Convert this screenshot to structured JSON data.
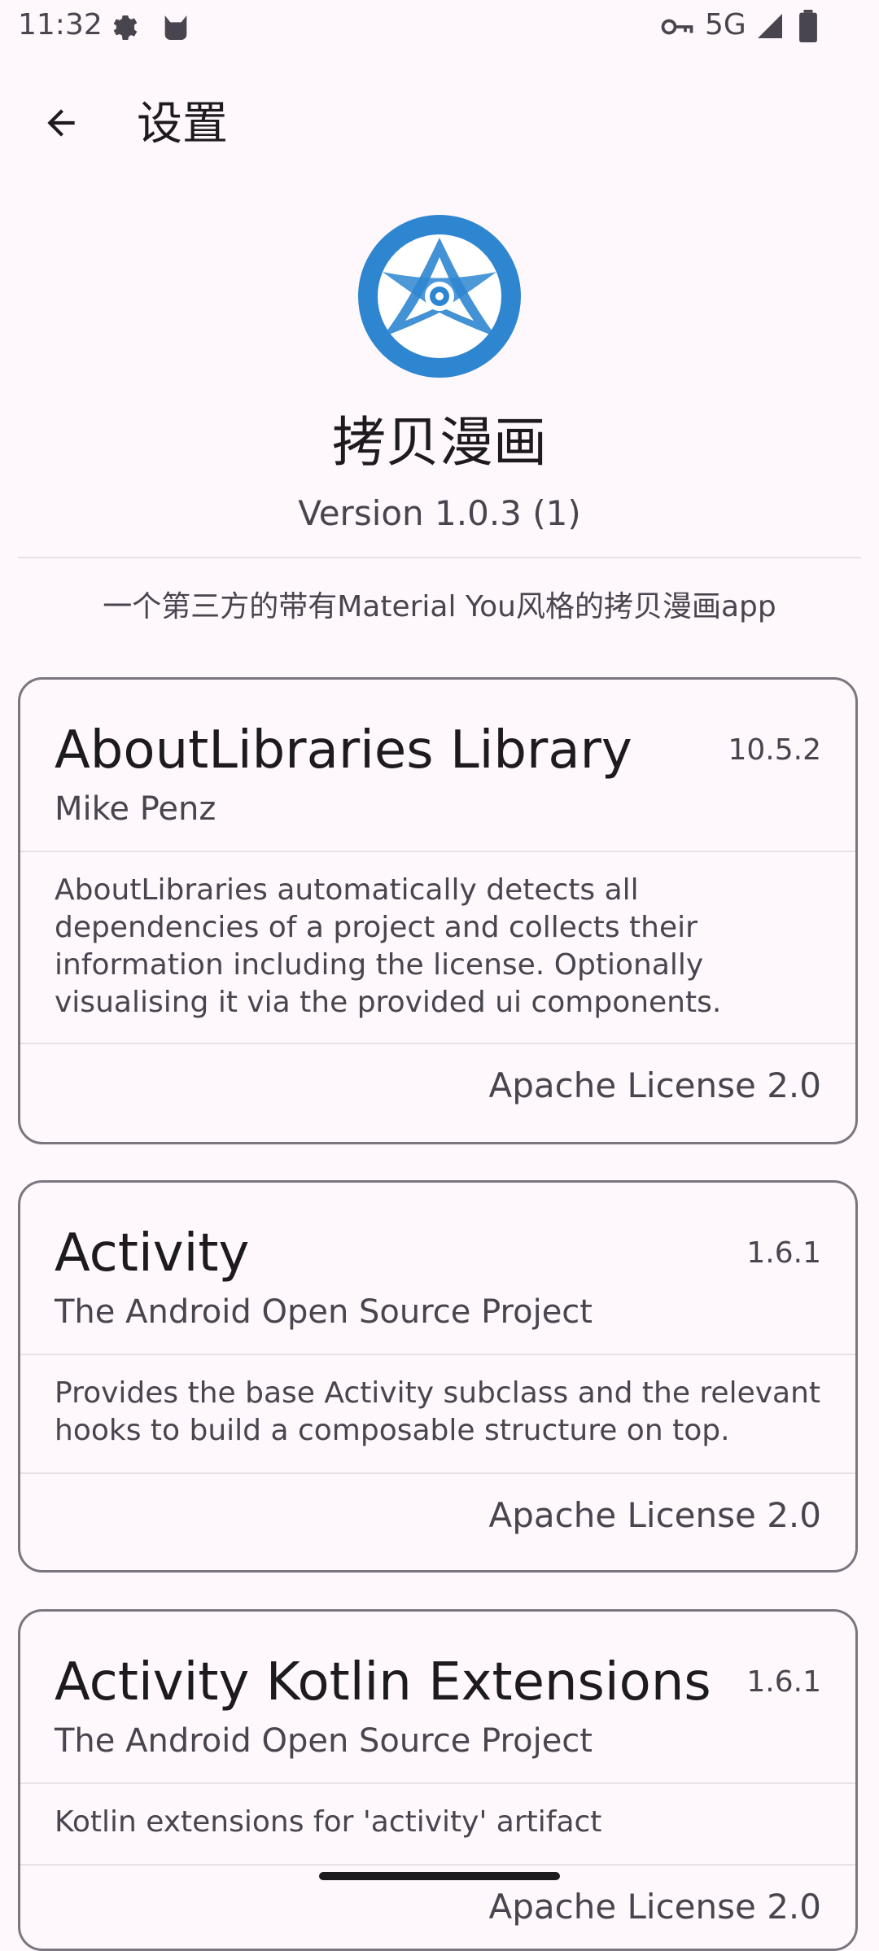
{
  "status_bar": {
    "time": "11:32",
    "network": "5G",
    "icons": [
      "settings-gear-icon",
      "cat-icon",
      "vpn-key-icon",
      "signal-icon",
      "battery-icon"
    ]
  },
  "app_bar": {
    "title": "设置",
    "back_icon": "arrow-back-icon"
  },
  "about": {
    "app_name": "拷贝漫画",
    "version": "Version 1.0.3 (1)",
    "description": "一个第三方的带有Material You风格的拷贝漫画app",
    "logo_color": "#2E86D0"
  },
  "libraries": [
    {
      "name": "AboutLibraries Library",
      "version": "10.5.2",
      "author": "Mike Penz",
      "description": "AboutLibraries automatically detects all dependencies of a project and collects their information including the license. Optionally visualising it via the provided ui components.",
      "license": "Apache License 2.0"
    },
    {
      "name": "Activity",
      "version": "1.6.1",
      "author": "The Android Open Source Project",
      "description": "Provides the base Activity subclass and the relevant hooks to build a composable structure on top.",
      "license": "Apache License 2.0"
    },
    {
      "name": "Activity Kotlin Extensions",
      "version": "1.6.1",
      "author": "The Android Open Source Project",
      "description": "Kotlin extensions for 'activity' artifact",
      "license": "Apache License 2.0"
    }
  ],
  "colors": {
    "background": "#FEF7FB",
    "outline": "#7A757F",
    "text_primary": "#1D1B1E",
    "text_secondary": "#49454F"
  }
}
